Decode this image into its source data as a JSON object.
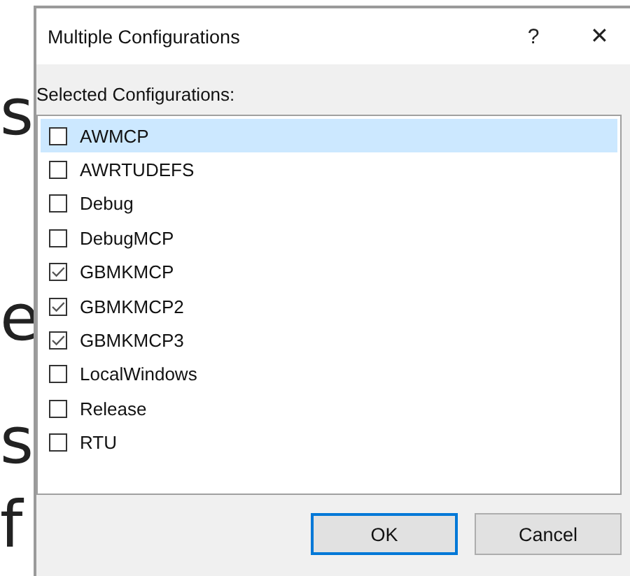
{
  "background_letters": [
    "s",
    "e",
    "s",
    "f"
  ],
  "window": {
    "title": "Multiple Configurations",
    "help": "?",
    "close": "✕"
  },
  "list_label": "Selected Configurations:",
  "items": [
    {
      "label": "AWMCP",
      "checked": false,
      "selected": true
    },
    {
      "label": "AWRTUDEFS",
      "checked": false,
      "selected": false
    },
    {
      "label": "Debug",
      "checked": false,
      "selected": false
    },
    {
      "label": "DebugMCP",
      "checked": false,
      "selected": false
    },
    {
      "label": "GBMKMCP",
      "checked": true,
      "selected": false
    },
    {
      "label": "GBMKMCP2",
      "checked": true,
      "selected": false
    },
    {
      "label": "GBMKMCP3",
      "checked": true,
      "selected": false
    },
    {
      "label": "LocalWindows",
      "checked": false,
      "selected": false
    },
    {
      "label": "Release",
      "checked": false,
      "selected": false
    },
    {
      "label": "RTU",
      "checked": false,
      "selected": false
    }
  ],
  "buttons": [
    {
      "label": "OK",
      "default": true
    },
    {
      "label": "Cancel",
      "default": false
    }
  ]
}
